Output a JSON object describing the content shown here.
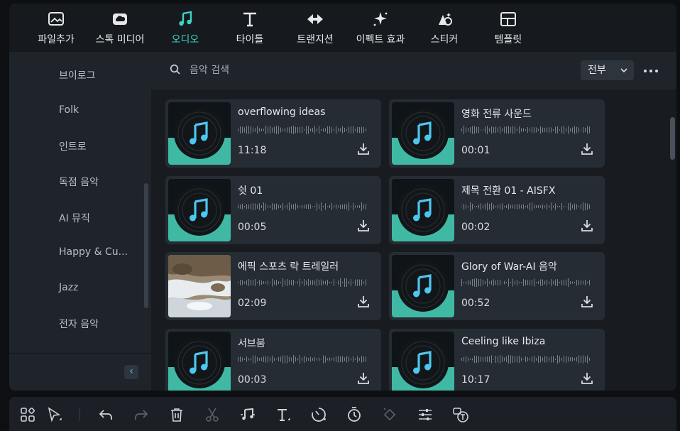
{
  "nav": {
    "items": [
      {
        "label": "파일추가",
        "icon": "image-import-icon"
      },
      {
        "label": "스톡 미디어",
        "icon": "cloud-image-icon"
      },
      {
        "label": "오디오",
        "icon": "music-note-icon",
        "active": true
      },
      {
        "label": "타이틀",
        "icon": "text-t-icon"
      },
      {
        "label": "트랜지션",
        "icon": "transition-arrows-icon"
      },
      {
        "label": "이펙트 효과",
        "icon": "sparkle-effect-icon"
      },
      {
        "label": "스티커",
        "icon": "sticker-icon"
      },
      {
        "label": "템플릿",
        "icon": "template-grid-icon"
      }
    ]
  },
  "sidebar": {
    "items": [
      {
        "label": "브이로그"
      },
      {
        "label": "Folk"
      },
      {
        "label": "인트로"
      },
      {
        "label": "독점 음악"
      },
      {
        "label": "AI 뮤직"
      },
      {
        "label": "Happy & Cu..."
      },
      {
        "label": "Jazz"
      },
      {
        "label": "전자 음악"
      }
    ],
    "collapse_icon": "chevron-left-icon"
  },
  "search": {
    "placeholder": "음악 검색",
    "filter_label": "전부"
  },
  "tracks": [
    {
      "title": "overflowing ideas",
      "duration": "11:18",
      "thumb": "music-disc"
    },
    {
      "title": "영화 전류 사운드",
      "duration": "00:01",
      "thumb": "music-disc"
    },
    {
      "title": "쉿 01",
      "duration": "00:05",
      "thumb": "music-disc"
    },
    {
      "title": "제목 전환 01 - AISFX",
      "duration": "00:02",
      "thumb": "music-disc"
    },
    {
      "title": "에픽 스포츠 락 트레일러",
      "duration": "02:09",
      "thumb": "waterfall-photo"
    },
    {
      "title": "Glory of War-AI 음악",
      "duration": "00:52",
      "thumb": "music-disc"
    },
    {
      "title": "서브붐",
      "duration": "00:03",
      "thumb": "music-disc"
    },
    {
      "title": "Ceeling like Ibiza",
      "duration": "10:17",
      "thumb": "music-disc"
    }
  ],
  "toolbar": {
    "icons": [
      "layout-grid-icon",
      "select-pointer-icon",
      "undo-icon",
      "redo-icon",
      "delete-icon",
      "cut-icon",
      "audio-edit-icon",
      "text-tool-icon",
      "speed-icon",
      "timer-icon",
      "keyframe-icon",
      "adjust-sliders-icon",
      "speech-to-text-icon"
    ]
  },
  "colors": {
    "accent": "#3ed4c4",
    "panel": "#1f242b",
    "card": "#262c34"
  }
}
